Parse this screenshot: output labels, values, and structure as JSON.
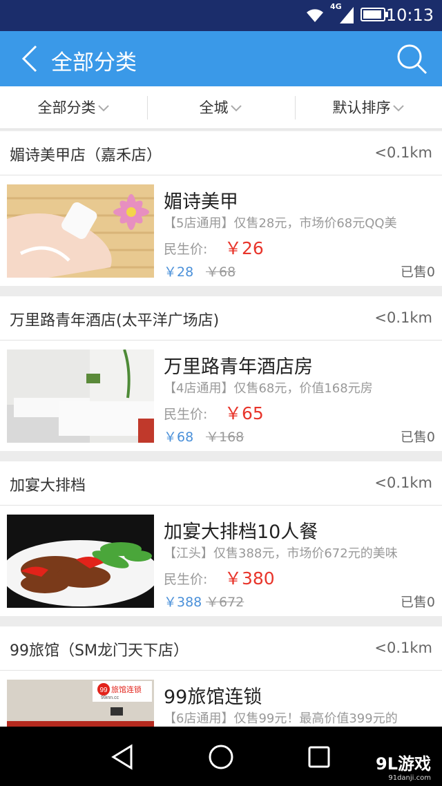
{
  "status_bar": {
    "time": "10:13",
    "network": "4G"
  },
  "header": {
    "title": "全部分类"
  },
  "filters": [
    {
      "label": "全部分类"
    },
    {
      "label": "全城"
    },
    {
      "label": "默认排序"
    }
  ],
  "deals": [
    {
      "store": "媚诗美甲店（嘉禾店）",
      "distance": "<0.1km",
      "title": "媚诗美甲",
      "desc": "【5店通用】仅售28元，市场价68元QQ美",
      "price_label": "民生价:",
      "price": "￥26",
      "orig_price": "￥28",
      "market_price": "￥68",
      "sold": "已售0"
    },
    {
      "store": "万里路青年酒店(太平洋广场店)",
      "distance": "<0.1km",
      "title": "万里路青年酒店房",
      "desc": "【4店通用】仅售68元，价值168元房",
      "price_label": "民生价:",
      "price": "￥65",
      "orig_price": "￥68",
      "market_price": "￥168",
      "sold": "已售0"
    },
    {
      "store": "加宴大排档",
      "distance": "<0.1km",
      "title": "加宴大排档10人餐",
      "desc": "【江头】仅售388元，市场价672元的美味",
      "price_label": "民生价:",
      "price": "￥380",
      "orig_price": "￥388",
      "market_price": "￥672",
      "sold": "已售0"
    },
    {
      "store": "99旅馆（SM龙门天下店）",
      "distance": "<0.1km",
      "title": "99旅馆连锁",
      "desc": "【6店通用】仅售99元！最高价值399元的",
      "price_label": "",
      "price": "",
      "orig_price": "",
      "market_price": "",
      "sold": "",
      "thumb_text": "旅馆连锁",
      "thumb_logo": "99",
      "thumb_url": "99inn.cc"
    }
  ],
  "watermark": {
    "brand": "9L游戏",
    "site": "91danji.com"
  },
  "colors": {
    "accent": "#3a99e8",
    "price": "#e8352b",
    "status_bar": "#1b2d6b"
  },
  "icons": [
    "wifi-icon",
    "signal-icon",
    "battery-icon",
    "back-arrow-icon",
    "search-icon",
    "chevron-down-icon",
    "nav-back-icon",
    "nav-home-icon",
    "nav-recent-icon"
  ]
}
